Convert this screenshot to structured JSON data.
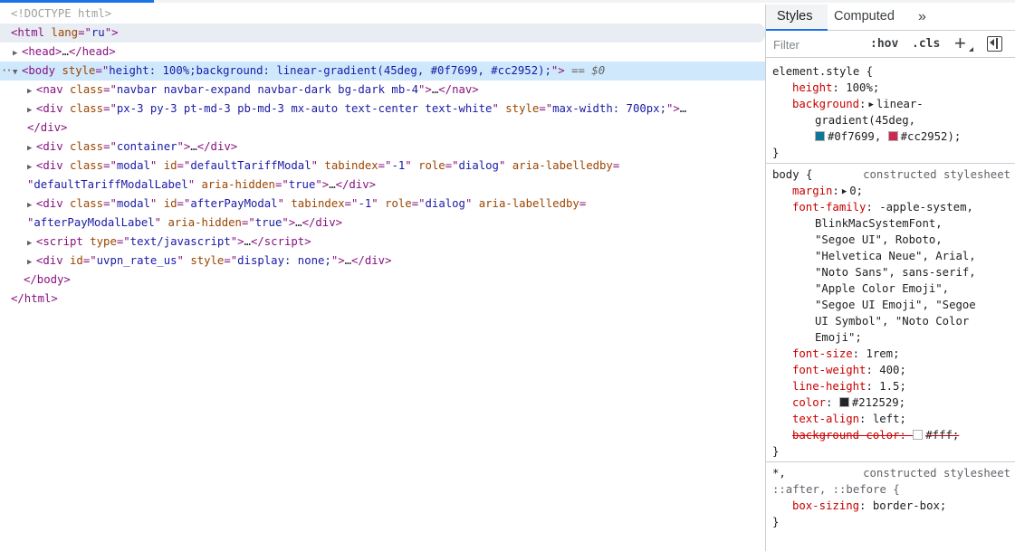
{
  "colors": {
    "accent": "#1a73e8",
    "selected_row": "#cfe8fc",
    "hover_row": "#e8edf3",
    "tag": "#881280",
    "attr_name": "#994500",
    "attr_value": "#1a1aa6",
    "css_property": "#c80000"
  },
  "icons": [
    "expand-triangle-icon",
    "collapse-triangle-icon",
    "more-tabs-chevron-icon",
    "new-style-rule-plus-icon",
    "toggle-sidebar-icon"
  ],
  "dom": {
    "doctype": "<!DOCTYPE html>",
    "html_open": {
      "tag": "html",
      "attr": "lang",
      "value": "ru"
    },
    "head": {
      "tag": "head",
      "ellipsis": "…"
    },
    "body": {
      "tag": "body",
      "attr": "style",
      "value": "height: 100%;background: linear-gradient(45deg, #0f7699, #cc2952);",
      "ref": "== $0"
    },
    "nav": {
      "tag": "nav",
      "attr": "class",
      "value": "navbar navbar-expand navbar-dark bg-dark mb-4",
      "ellipsis": "…"
    },
    "div1": {
      "tag": "div",
      "attr1": "class",
      "val1": "px-3 py-3 pt-md-3 pb-md-3 mx-auto text-center text-white",
      "attr2": "style",
      "val2": "max-width: 700px;",
      "ellipsis": "…"
    },
    "div_close": "</div>",
    "container": {
      "tag": "div",
      "attr": "class",
      "value": "container",
      "ellipsis": "…"
    },
    "modal1": {
      "tag": "div",
      "a1": "class",
      "v1": "modal",
      "a2": "id",
      "v2": "defaultTariffModal",
      "a3": "tabindex",
      "v3": "-1",
      "a4": "role",
      "v4": "dialog",
      "a5": "aria-labelledby",
      "v5": "defaultTariffModalLabel",
      "a6": "aria-hidden",
      "v6": "true",
      "ellipsis": "…"
    },
    "modal2": {
      "tag": "div",
      "a1": "class",
      "v1": "modal",
      "a2": "id",
      "v2": "afterPayModal",
      "a3": "tabindex",
      "v3": "-1",
      "a4": "role",
      "v4": "dialog",
      "a5": "aria-labelledby",
      "v5": "afterPayModalLabel",
      "a6": "aria-hidden",
      "v6": "true",
      "ellipsis": "…"
    },
    "script": {
      "tag": "script",
      "attr": "type",
      "value": "text/javascript",
      "ellipsis": "…"
    },
    "rate": {
      "tag": "div",
      "a1": "id",
      "v1": "uvpn_rate_us",
      "a2": "style",
      "v2": "display: none;",
      "ellipsis": "…"
    },
    "body_close": "</body>",
    "html_close": "</html>"
  },
  "styles_panel": {
    "tabs": [
      "Styles",
      "Computed"
    ],
    "more_tabs": "»",
    "filter_placeholder": "Filter",
    "hov_label": ":hov",
    "cls_label": ".cls",
    "plus_label": "+",
    "rules": {
      "element_style": {
        "selector": "element.style {",
        "height_prop": "height",
        "height_val": "100%;",
        "bg_prop": "background",
        "bg_val1": "linear-",
        "bg_val2": "gradient(45deg,",
        "color1": "#0f7699",
        "color1_sep": ",",
        "color2": "#cc2952",
        "color2_end": ");",
        "close": "}"
      },
      "body": {
        "selector": "body {",
        "origin": "constructed stylesheet",
        "margin_prop": "margin",
        "margin_val": "0;",
        "ff_prop": "font-family",
        "ff_lines": [
          "-apple-system,",
          "BlinkMacSystemFont,",
          "\"Segoe UI\", Roboto,",
          "\"Helvetica Neue\", Arial,",
          "\"Noto Sans\", sans-serif,",
          "\"Apple Color Emoji\",",
          "\"Segoe UI Emoji\", \"Segoe",
          "UI Symbol\", \"Noto Color",
          "Emoji\";"
        ],
        "fs_prop": "font-size",
        "fs_val": "1rem;",
        "fw_prop": "font-weight",
        "fw_val": "400;",
        "lh_prop": "line-height",
        "lh_val": "1.5;",
        "color_prop": "color",
        "color_val": "#212529;",
        "ta_prop": "text-align",
        "ta_val": "left;",
        "bgc_prop": "background-color",
        "bgc_val": "#fff;",
        "close": "}"
      },
      "universal": {
        "selector1": "*,",
        "origin": "constructed stylesheet",
        "selector2": "::after, ::before {",
        "bs_prop": "box-sizing",
        "bs_val": "border-box;",
        "close": "}"
      }
    }
  }
}
